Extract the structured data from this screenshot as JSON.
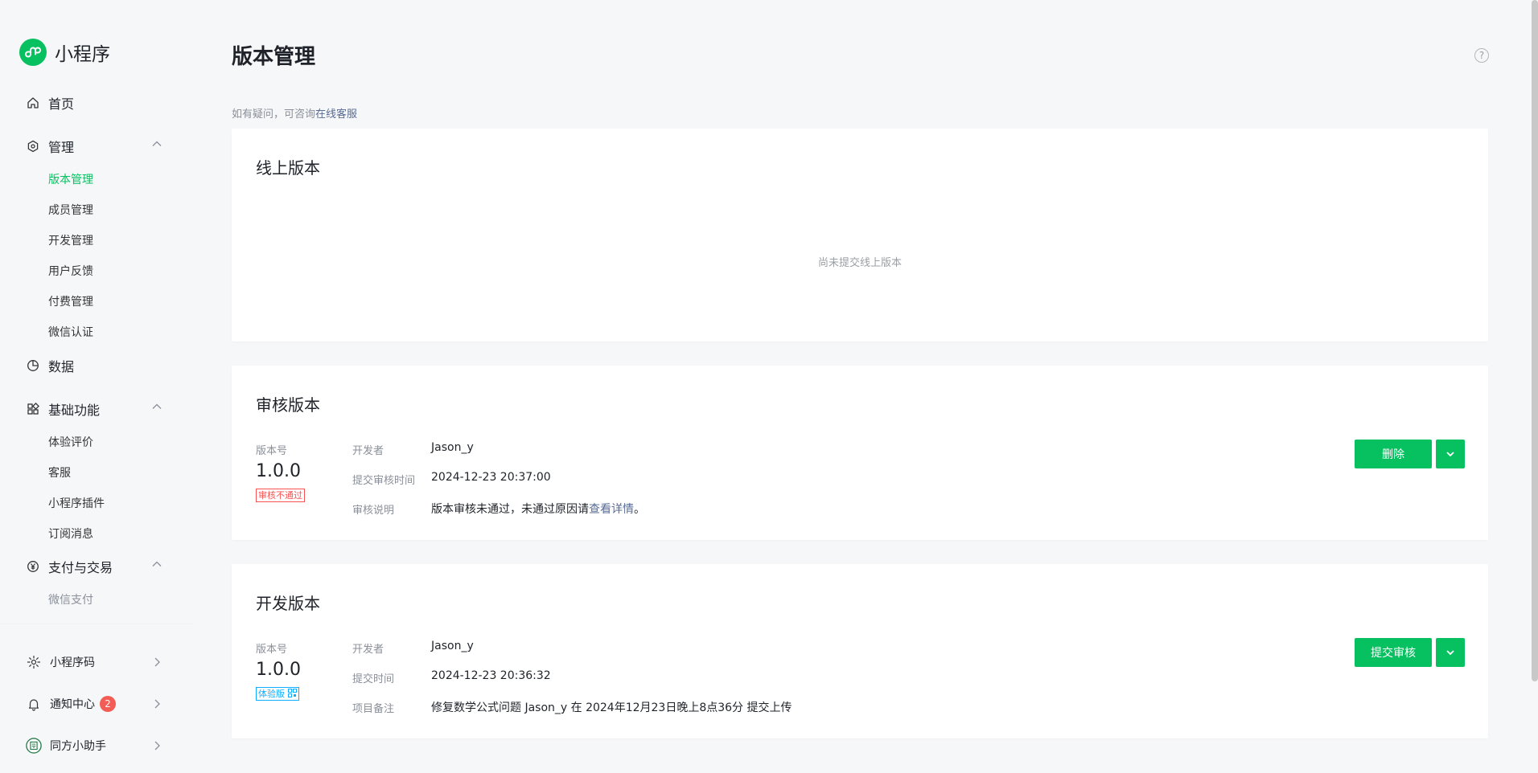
{
  "app": {
    "title": "小程序",
    "brand_color": "#07c160"
  },
  "sidebar": {
    "home": {
      "label": "首页",
      "icon": "home-icon"
    },
    "manage": {
      "label": "管理",
      "icon": "settings-hex-icon",
      "items": [
        "版本管理",
        "成员管理",
        "开发管理",
        "用户反馈",
        "付费管理",
        "微信认证"
      ],
      "active": "版本管理"
    },
    "data": {
      "label": "数据",
      "icon": "pie-chart-icon"
    },
    "basic": {
      "label": "基础功能",
      "icon": "grid-icon",
      "items": [
        "体验评价",
        "客服",
        "小程序插件",
        "订阅消息"
      ]
    },
    "pay": {
      "label": "支付与交易",
      "icon": "yen-icon",
      "items": [
        "微信支付"
      ]
    },
    "footer": {
      "code": {
        "label": "小程序码",
        "icon": "sun-code-icon"
      },
      "notify": {
        "label": "通知中心",
        "icon": "bell-icon",
        "badge": "2"
      },
      "assistant": {
        "label": "同方小助手",
        "icon": "avatar-icon"
      }
    }
  },
  "main": {
    "title": "版本管理",
    "hint_prefix": "如有疑问，可咨询",
    "hint_link": "在线客服",
    "online": {
      "title": "线上版本",
      "empty": "尚未提交线上版本"
    },
    "review": {
      "title": "审核版本",
      "version_label": "版本号",
      "version": "1.0.0",
      "tag": "审核不通过",
      "developer_key": "开发者",
      "developer": "Jason_y",
      "time_key": "提交审核时间",
      "time": "2024-12-23 20:37:00",
      "note_key": "审核说明",
      "note_prefix": "版本审核未通过，未通过原因请",
      "note_link": "查看详情",
      "note_suffix": "。",
      "button": "删除"
    },
    "dev": {
      "title": "开发版本",
      "version_label": "版本号",
      "version": "1.0.0",
      "tag": "体验版 ",
      "developer_key": "开发者",
      "developer": "Jason_y",
      "time_key": "提交时间",
      "time": "2024-12-23 20:36:32",
      "note_key": "项目备注",
      "note": "修复数学公式问题 Jason_y 在 2024年12月23日晚上8点36分 提交上传",
      "button": "提交审核"
    }
  }
}
